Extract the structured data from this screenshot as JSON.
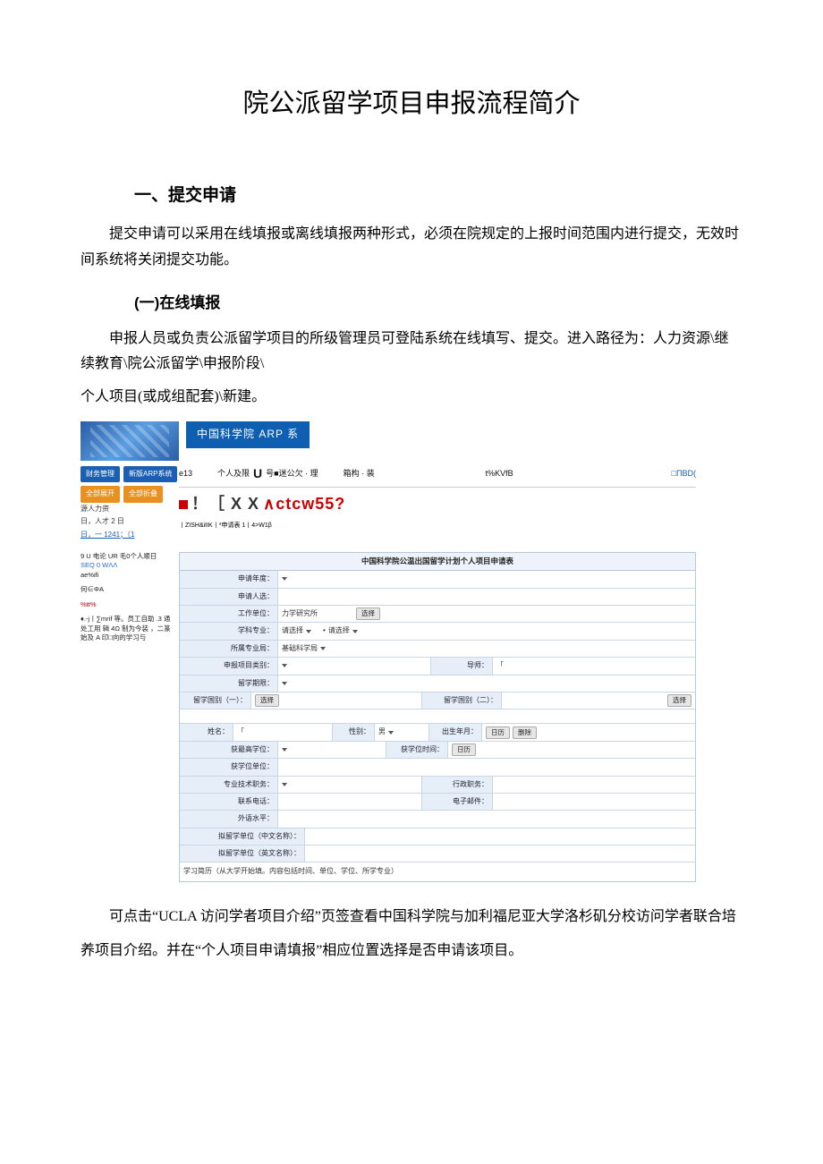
{
  "doc": {
    "title": "院公派留学项目申报流程简介",
    "section1": "一、提交申请",
    "para1": "提交申请可以采用在线填报或离线填报两种形式，必须在院规定的上报时间范围内进行提交，无效时间系统将关闭提交功能。",
    "sub1": "(一)在线填报",
    "para2": "申报人员或负责公派留学项目的所级管理员可登陆系统在线填写、提交。进入路径为：人力资源\\继续教育\\院公派留学\\申报阶段\\",
    "para3": "个人项目(或成组配套)\\新建。",
    "para4": "可点击“UCLA 访问学者项目介绍”页签查看中国科学院与加利福尼亚大学洛杉矶分校访问学者联合培养项目介绍。并在“个人项目申请填报”相应位置选择是否申请该项目。"
  },
  "screenshot": {
    "arp_title": "中国科学院 ARP 系",
    "nav": {
      "a": "财务管理",
      "b": "新版ARP系统",
      "c": "全部展开",
      "d": "全部折叠"
    },
    "leftline1": "源人力资",
    "leftline2": "日，人才 2 日",
    "leftline3": "日，一 1241；〔1",
    "mid1_a": "e13",
    "mid1_b": "个人及限",
    "mid1_c": "号■迷公欠 · 理",
    "mid1_d": "箱构 · 装",
    "mid1_e": "t%KVfB",
    "mid1_link": "□ПВD(",
    "garble_big": "！［ X X",
    "garble_small": "丨ZISH&iIIK丨*申请表 1丨4>W1β",
    "garble_tail": "∧ctcw55?",
    "side": {
      "p1a": "9 U 电论 UR 毛0个人顺日",
      "p1b": "SEQ 0 WΛΛ",
      "p1c": "ae%ifi",
      "p2": "何∈ΦA",
      "p3": "%tt%",
      "p4": "♦.-j丨∑mrif 等。员工自助 .3 通处工用 辑 4Ω 制为今装 ，二篆始及 A 印□向的学习与"
    },
    "form": {
      "title": "中国科学院公温出国留学计划个人项目申请表",
      "labels": {
        "year": "申请年度：",
        "applicant": "申请人选：",
        "work_unit": "工作单位：",
        "subject": "学科专业：",
        "base": "所属专业局：",
        "category": "申报项目类别：",
        "duration": "留学期限：",
        "country1": "留学国别（一）：",
        "country2": "留学国别（二）：",
        "name": "姓名：",
        "gender": "性别：",
        "birth": "出生年月：",
        "highest_edu": "获最高学位：",
        "edu_time": "获学位时间：",
        "edu_unit": "获学位单位：",
        "tech_title": "专业技术职务：",
        "admin_title": "行政职务：",
        "phone": "联系电话：",
        "email": "电子邮件：",
        "lang": "外语水平：",
        "inst_cn": "拟留学单位（中文名称）：",
        "inst_en": "拟留学单位（英文名称）："
      },
      "values": {
        "work_unit": "力学研究所",
        "subject": "请选择",
        "subject2": "请选择",
        "base": "基础科学局",
        "gender": "男",
        "btn_select": "选择",
        "btn_date": "日历",
        "btn_clear": "删除",
        "tutor": "导师："
      },
      "footnote": "学习简历（从大学开始填。内容包括时间、单位、学位、所学专业）"
    }
  }
}
